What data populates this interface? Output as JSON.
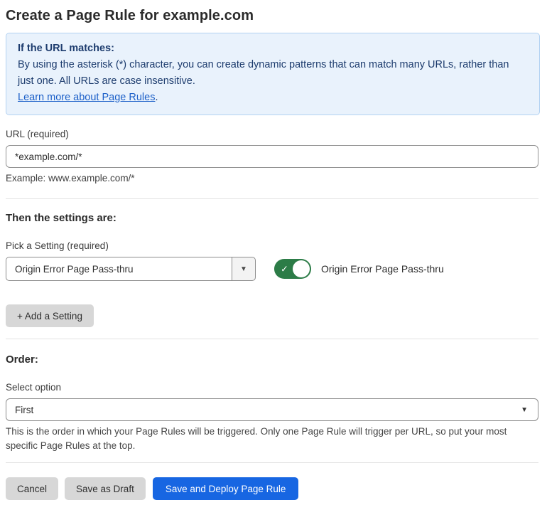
{
  "page": {
    "title": "Create a Page Rule for example.com"
  },
  "info_box": {
    "heading": "If the URL matches:",
    "body": "By using the asterisk (*) character, you can create dynamic patterns that can match many URLs, rather than just one. All URLs are case insensitive.",
    "link": "Learn more about Page Rules",
    "link_suffix": "."
  },
  "url_field": {
    "label": "URL (required)",
    "value": "*example.com/*",
    "hint": "Example: www.example.com/*"
  },
  "settings": {
    "heading": "Then the settings are:",
    "pick_label": "Pick a Setting (required)",
    "selected_setting": "Origin Error Page Pass-thru",
    "toggle": {
      "state": "on",
      "label": "Origin Error Page Pass-thru"
    },
    "add_button": "+ Add a Setting"
  },
  "order": {
    "heading": "Order:",
    "label": "Select option",
    "selected_option": "First",
    "help": "This is the order in which your Page Rules will be triggered. Only one Page Rule will trigger per URL, so put your most specific Page Rules at the top."
  },
  "footer": {
    "cancel": "Cancel",
    "save_draft": "Save as Draft",
    "save_deploy": "Save and Deploy Page Rule"
  },
  "icons": {
    "check": "✓",
    "caret_down": "▼"
  },
  "colors": {
    "accent_blue": "#1766e2",
    "toggle_green": "#2c7c47",
    "info_bg": "#e9f2fc",
    "info_border": "#b3d2f2",
    "info_text": "#1d3c6e",
    "link_blue": "#1b5fc8"
  }
}
